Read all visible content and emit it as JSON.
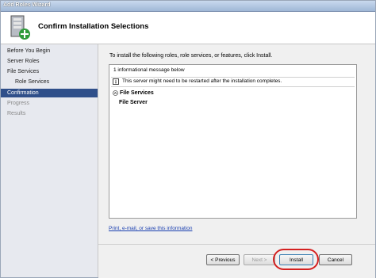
{
  "window": {
    "title": "Add Roles Wizard"
  },
  "header": {
    "title": "Confirm Installation Selections",
    "icon": "server-roles-icon"
  },
  "sidebar": {
    "items": [
      {
        "label": "Before You Begin",
        "state": "normal"
      },
      {
        "label": "Server Roles",
        "state": "normal"
      },
      {
        "label": "File Services",
        "state": "normal"
      },
      {
        "label": "Role Services",
        "state": "normal"
      },
      {
        "label": "Confirmation",
        "state": "active"
      },
      {
        "label": "Progress",
        "state": "disabled"
      },
      {
        "label": "Results",
        "state": "disabled"
      }
    ]
  },
  "main": {
    "intro": "To install the following roles, role services, or features, click Install.",
    "info_count": "1 informational message below",
    "warning": "This server might need to be restarted after the installation completes.",
    "section_title": "File Services",
    "section_item": "File Server",
    "link": "Print, e-mail, or save this information"
  },
  "footer": {
    "previous": "< Previous",
    "next": "Next >",
    "install": "Install",
    "cancel": "Cancel"
  },
  "colors": {
    "active_nav": "#2f4f8a",
    "highlight": "#d42020",
    "link": "#1a3fb0"
  }
}
